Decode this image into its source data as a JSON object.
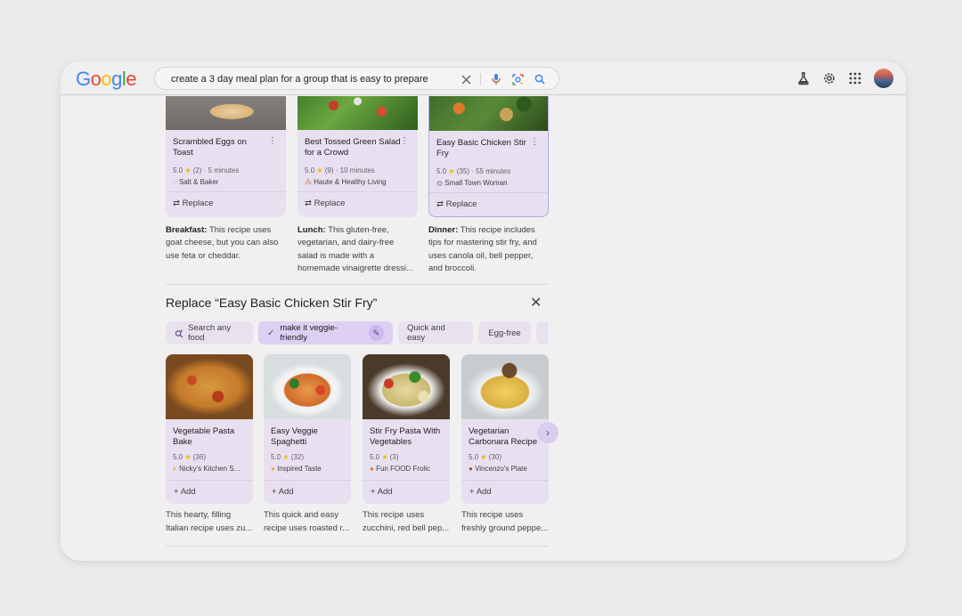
{
  "header": {
    "logo": "Google",
    "search": {
      "value": "create a 3 day meal plan for a group that is easy to prepare"
    }
  },
  "meals": [
    {
      "title": "Scrambled Eggs on Toast",
      "rating": "5.0",
      "reviews": "(2)",
      "time": "5 minutes",
      "source": "Salt & Baker",
      "replace_label": "Replace",
      "desc_label": "Breakfast:",
      "desc_text": "This recipe uses goat cheese, but you can also use feta or cheddar."
    },
    {
      "title": "Best Tossed Green Salad for a Crowd",
      "rating": "5.0",
      "reviews": "(9)",
      "time": "10 minutes",
      "source": "Haute & Healthy Living",
      "replace_label": "Replace",
      "desc_label": "Lunch:",
      "desc_text": "This gluten-free, vegetarian, and dairy-free salad is made with a homemade vinaigrette dressi..."
    },
    {
      "title": "Easy Basic Chicken Stir Fry",
      "rating": "5.0",
      "reviews": "(35)",
      "time": "55 minutes",
      "source": "Small Town Woman",
      "replace_label": "Replace",
      "desc_label": "Dinner:",
      "desc_text": "This recipe includes tips for mastering stir fry, and uses canola oil, bell pepper, and broccoli."
    }
  ],
  "replace_panel": {
    "heading": "Replace “Easy Basic Chicken Stir Fry”",
    "chips": [
      {
        "label": "Search any food"
      },
      {
        "label": "make it veggie-friendly"
      },
      {
        "label": "Quick and easy"
      },
      {
        "label": "Egg-free"
      }
    ],
    "recipes": [
      {
        "title": "Vegetable Pasta Bake",
        "rating": "5.0",
        "reviews": "(36)",
        "source": "Nicky's Kitchen S...",
        "add_label": "Add",
        "desc_1": "This hearty, filling",
        "desc_2": "Italian recipe uses zu..."
      },
      {
        "title": "Easy Veggie Spaghetti",
        "rating": "5.0",
        "reviews": "(32)",
        "source": "Inspired Taste",
        "add_label": "Add",
        "desc_1": "This quick and easy",
        "desc_2": "recipe uses roasted r..."
      },
      {
        "title": "Stir Fry Pasta With Vegetables",
        "rating": "5.0",
        "reviews": "(3)",
        "source": "Fun FOOD Frolic",
        "add_label": "Add",
        "desc_1": "This recipe uses",
        "desc_2": "zucchini, red bell pep..."
      },
      {
        "title": "Vegetarian Carbonara Recipe",
        "rating": "5.0",
        "reviews": "(30)",
        "source": "Vincenzo's Plate",
        "add_label": "Add",
        "desc_1": "This recipe uses",
        "desc_2": "freshly ground peppe..."
      }
    ]
  },
  "colors": {
    "card_bg": "#e8e0f0",
    "accent": "#8a6fd1",
    "star": "#f4b400"
  }
}
